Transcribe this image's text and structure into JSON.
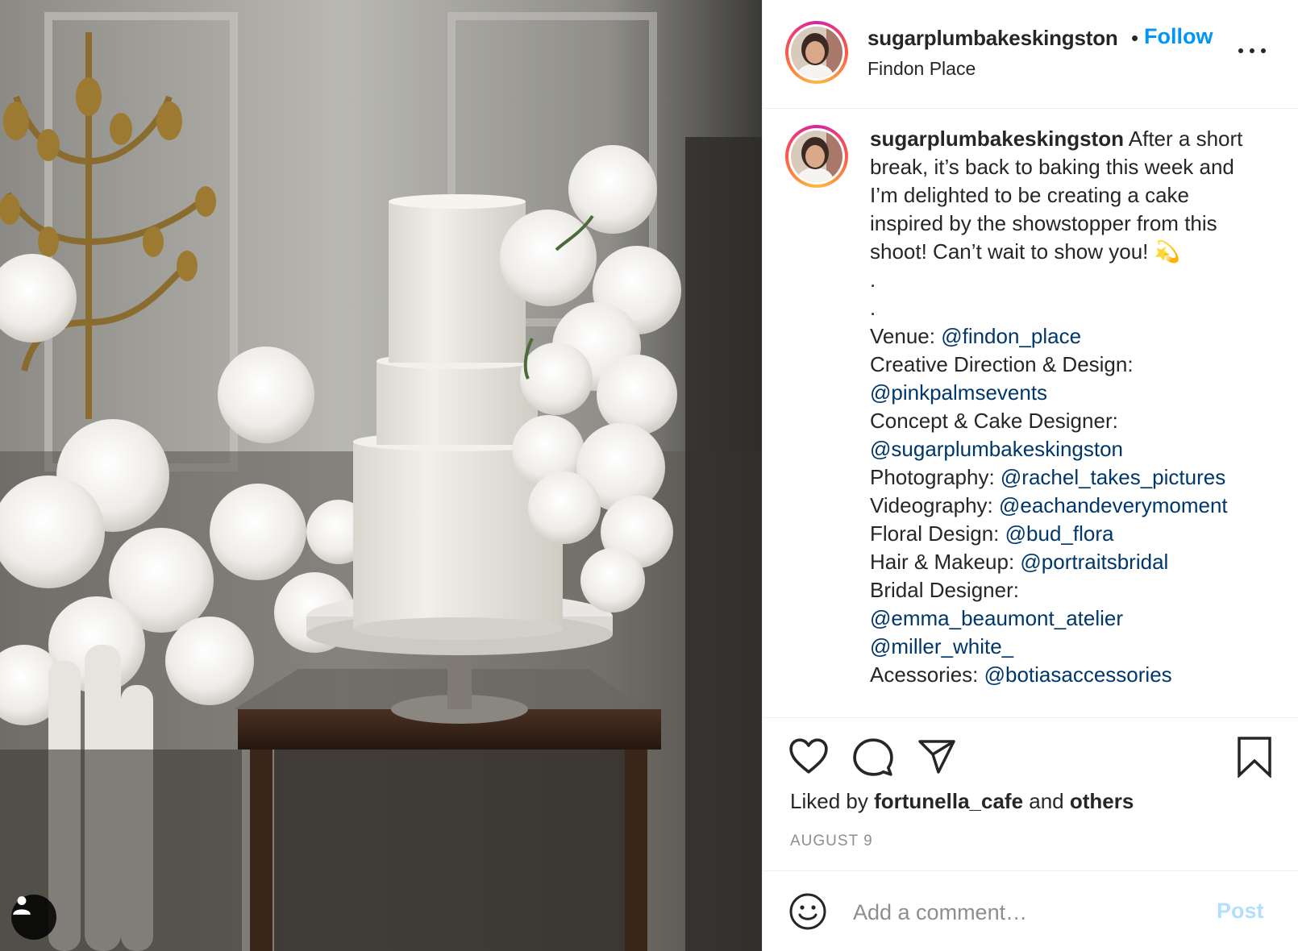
{
  "post": {
    "username": "sugarplumbakeskingston",
    "follow_label": "Follow",
    "location": "Findon Place",
    "more_icon": "more-horizontal-icon"
  },
  "caption": {
    "username": "sugarplumbakeskingston",
    "intro_1": "After a short",
    "intro_2": "break, it’s back to baking this week and",
    "intro_3": "I’m delighted to be creating a cake",
    "intro_4": "inspired by the showstopper from this",
    "intro_5": "shoot! Can’t wait to show you! 💫",
    "dot_1": ".",
    "dot_2": ".",
    "credits": [
      {
        "label": "Venue: ",
        "mention": "@findon_place"
      },
      {
        "label": "Creative Direction & Design:",
        "mention": ""
      },
      {
        "label": "",
        "mention": "@pinkpalmsevents"
      },
      {
        "label": "Concept & Cake Designer:",
        "mention": ""
      },
      {
        "label": "",
        "mention": "@sugarplumbakeskingston"
      },
      {
        "label": "Photography: ",
        "mention": "@rachel_takes_pictures"
      },
      {
        "label": "Videography: ",
        "mention": "@eachandeverymoment"
      },
      {
        "label": "Floral Design: ",
        "mention": "@bud_flora"
      },
      {
        "label": "Hair & Makeup: ",
        "mention": "@portraitsbridal"
      },
      {
        "label": "Bridal Designer:",
        "mention": ""
      },
      {
        "label": "",
        "mention": "@emma_beaumont_atelier"
      },
      {
        "label": "",
        "mention": "@miller_white_"
      },
      {
        "label": "Acessories: ",
        "mention": "@botiasaccessories"
      }
    ]
  },
  "actions": {
    "like_icon": "heart-icon",
    "comment_icon": "comment-bubble-icon",
    "share_icon": "paper-plane-icon",
    "save_icon": "bookmark-icon",
    "liked_by_prefix": "Liked by ",
    "liked_by_user": "fortunella_cafe",
    "liked_by_and": " and ",
    "liked_by_others": "others",
    "date": "AUGUST 9"
  },
  "comment": {
    "emoji_icon": "smiley-icon",
    "placeholder": "Add a comment…",
    "post_label": "Post"
  },
  "photo": {
    "tag_icon": "user-tag-icon"
  },
  "colors": {
    "link": "#0095f6",
    "mention": "#00376b",
    "post_disabled": "#b2dffc",
    "muted": "#8e8e8e",
    "text": "#262626"
  }
}
